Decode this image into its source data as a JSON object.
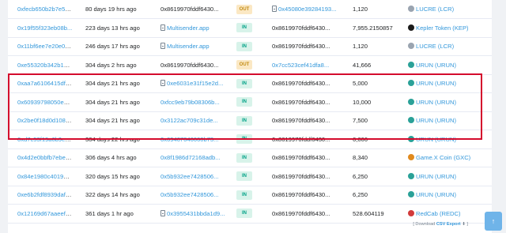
{
  "rows": [
    {
      "hash": "0xfecb650b2b7e5cc...",
      "age": "80 days 19 hrs ago",
      "from": "0x8619970fddf6430...",
      "from_doc": false,
      "from_link": false,
      "dir": "OUT",
      "to": "0x45080e39284193...",
      "to_doc": true,
      "to_link": true,
      "qty": "1,120",
      "token": "LUCRE (LCR)",
      "token_color": "#9aa4b0"
    },
    {
      "hash": "0x19f55f323eb08b...",
      "age": "223 days 13 hrs ago",
      "from": "Multisender.app",
      "from_doc": true,
      "from_link": true,
      "dir": "IN",
      "to": "0x8619970fddf6430...",
      "to_doc": false,
      "to_link": false,
      "qty": "7,955.2150857",
      "token": "Kepler Token (KEP)",
      "token_color": "#1a1a1a"
    },
    {
      "hash": "0x11bf6ee7e20e08b...",
      "age": "246 days 17 hrs ago",
      "from": "Multisender.app",
      "from_doc": true,
      "from_link": true,
      "dir": "IN",
      "to": "0x8619970fddf6430...",
      "to_doc": false,
      "to_link": false,
      "qty": "1,120",
      "token": "LUCRE (LCR)",
      "token_color": "#9aa4b0"
    },
    {
      "hash": "0xe55320b342b10b...",
      "age": "304 days 2 hrs ago",
      "from": "0x8619970fddf6430...",
      "from_doc": false,
      "from_link": false,
      "dir": "OUT",
      "to": "0x7cc523cef41dfa8...",
      "to_doc": false,
      "to_link": true,
      "qty": "41,666",
      "token": "URUN (URUN)",
      "token_color": "#2aa198"
    },
    {
      "hash": "0xaa7a6106415df7c...",
      "age": "304 days 21 hrs ago",
      "from": "0xe6031e31f15e2d...",
      "from_doc": true,
      "from_link": true,
      "dir": "IN",
      "to": "0x8619970fddf6430...",
      "to_doc": false,
      "to_link": false,
      "qty": "5,000",
      "token": "URUN (URUN)",
      "token_color": "#2aa198"
    },
    {
      "hash": "0x60939798050ea6...",
      "age": "304 days 21 hrs ago",
      "from": "0xfcc9eb79b08306b...",
      "from_doc": false,
      "from_link": true,
      "dir": "IN",
      "to": "0x8619970fddf6430...",
      "to_doc": false,
      "to_link": false,
      "qty": "10,000",
      "token": "URUN (URUN)",
      "token_color": "#2aa198"
    },
    {
      "hash": "0x2be0f18d0d1088c...",
      "age": "304 days 21 hrs ago",
      "from": "0x3122ac709c31de...",
      "from_doc": false,
      "from_link": true,
      "dir": "IN",
      "to": "0x8619970fddf6430...",
      "to_doc": false,
      "to_link": false,
      "qty": "7,500",
      "token": "URUN (URUN)",
      "token_color": "#2aa198"
    },
    {
      "hash": "0xd7c53f19a6b9edf...",
      "age": "304 days 22 hrs ago",
      "from": "0x69407046660b73...",
      "from_doc": false,
      "from_link": true,
      "dir": "IN",
      "to": "0x8619970fddf6430...",
      "to_doc": false,
      "to_link": false,
      "qty": "6,666",
      "token": "URUN (URUN)",
      "token_color": "#2aa198"
    },
    {
      "hash": "0x4d2e0bbfb7ebead...",
      "age": "306 days 4 hrs ago",
      "from": "0x8f1986d72168adb...",
      "from_doc": false,
      "from_link": true,
      "dir": "IN",
      "to": "0x8619970fddf6430...",
      "to_doc": false,
      "to_link": false,
      "qty": "8,340",
      "token": "Game.X Coin (GXC)",
      "token_color": "#e08a1e"
    },
    {
      "hash": "0x84e1980c40193e...",
      "age": "320 days 15 hrs ago",
      "from": "0x5b932ee7428506...",
      "from_doc": false,
      "from_link": true,
      "dir": "IN",
      "to": "0x8619970fddf6430...",
      "to_doc": false,
      "to_link": false,
      "qty": "6,250",
      "token": "URUN (URUN)",
      "token_color": "#2aa198"
    },
    {
      "hash": "0xe6b2fdf8939dafc6...",
      "age": "322 days 14 hrs ago",
      "from": "0x5b932ee7428506...",
      "from_doc": false,
      "from_link": true,
      "dir": "IN",
      "to": "0x8619970fddf6430...",
      "to_doc": false,
      "to_link": false,
      "qty": "6,250",
      "token": "URUN (URUN)",
      "token_color": "#2aa198"
    },
    {
      "hash": "0x12169d67aaeefe0...",
      "age": "361 days 1 hr ago",
      "from": "0x3955431bbda1d9...",
      "from_doc": true,
      "from_link": true,
      "dir": "IN",
      "to": "0x8619970fddf6430...",
      "to_doc": false,
      "to_link": false,
      "qty": "528.604119",
      "token": "RedCab (REDC)",
      "token_color": "#d23b3b"
    }
  ],
  "footer": {
    "prefix": "[ Download ",
    "link": "CSV Export",
    "suffix": " ⬇ ]"
  },
  "scroll_top_label": "↑"
}
